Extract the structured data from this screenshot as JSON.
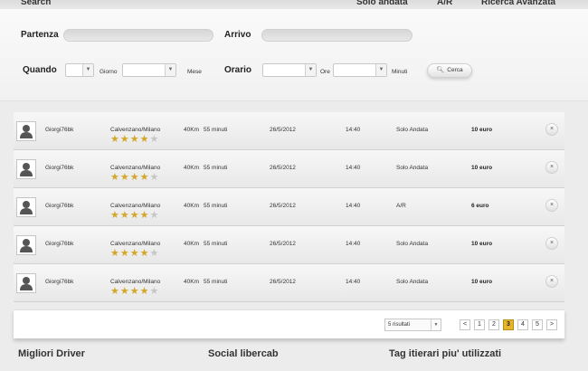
{
  "topbar": {
    "search_label": "Search",
    "tab_solo_andata": "Solo andata",
    "tab_ar": "A/R",
    "tab_ricerca_avanzata": "Ricerca Avanzata"
  },
  "search_form": {
    "partenza_label": "Partenza",
    "arrivo_label": "Arrivo",
    "quando_label": "Quando",
    "giorno_label": "Giorno",
    "mese_label": "Mese",
    "orario_label": "Orario",
    "ore_label": "Ore",
    "minuti_label": "Minuti",
    "cerca_label": "Cerca"
  },
  "results": [
    {
      "user": "Giorgi76bk",
      "route": "Calvenzano/Milano",
      "distance": "40Km",
      "duration": "55 minuti",
      "date": "26/5/2012",
      "time": "14:40",
      "trip_type": "Solo Andata",
      "price": "10 euro",
      "rating": 4
    },
    {
      "user": "Giorgi76bk",
      "route": "Calvenzano/Milano",
      "distance": "40Km",
      "duration": "55 minuti",
      "date": "26/5/2012",
      "time": "14:40",
      "trip_type": "Solo Andata",
      "price": "10 euro",
      "rating": 4
    },
    {
      "user": "Giorgi76bk",
      "route": "Calvenzano/Milano",
      "distance": "40Km",
      "duration": "55 minuti",
      "date": "26/5/2012",
      "time": "14:40",
      "trip_type": "A/R",
      "price": "6 euro",
      "rating": 4
    },
    {
      "user": "Giorgi76bk",
      "route": "Calvenzano/Milano",
      "distance": "40Km",
      "duration": "55 minuti",
      "date": "26/5/2012",
      "time": "14:40",
      "trip_type": "Solo Andata",
      "price": "10 euro",
      "rating": 4
    },
    {
      "user": "Giorgi76bk",
      "route": "Calvenzano/Milano",
      "distance": "40Km",
      "duration": "55 minuti",
      "date": "26/5/2012",
      "time": "14:40",
      "trip_type": "Solo Andata",
      "price": "10 euro",
      "rating": 4
    }
  ],
  "star_max": 5,
  "delete_glyph": "×",
  "pagination": {
    "results_per_page": "5 risultati",
    "prev": "<",
    "pages": [
      "1",
      "2",
      "3",
      "4",
      "5"
    ],
    "current": 3,
    "next": ">"
  },
  "footer": {
    "migliori_driver": "Migliori Driver",
    "social": "Social libercab",
    "tag": "Tag itierari piu' utilizzati"
  },
  "colors": {
    "accent": "#e6b52e",
    "star_on": "#d4a62a",
    "star_off": "#c6c6c6"
  }
}
